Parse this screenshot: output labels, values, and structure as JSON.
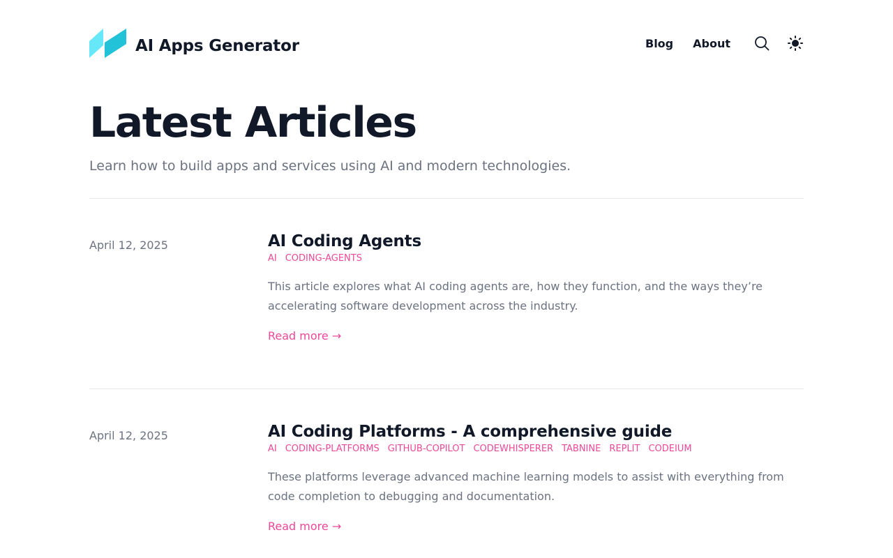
{
  "header": {
    "brand_name": "AI Apps Generator",
    "nav": [
      {
        "label": "Blog"
      },
      {
        "label": "About"
      }
    ],
    "icons": {
      "search": "search-icon",
      "theme": "sun-icon"
    }
  },
  "hero": {
    "title": "Latest Articles",
    "subtitle": "Learn how to build apps and services using AI and modern technologies."
  },
  "articles": [
    {
      "date": "April 12, 2025",
      "title": "AI Coding Agents",
      "tags": [
        "AI",
        "CODING-AGENTS"
      ],
      "excerpt": "This article explores what AI coding agents are, how they function, and the ways they’re accelerating software development across the industry.",
      "read_more": "Read more →"
    },
    {
      "date": "April 12, 2025",
      "title": "AI Coding Platforms - A comprehensive guide",
      "tags": [
        "AI",
        "CODING-PLATFORMS",
        "GITHUB-COPILOT",
        "CODEWHISPERER",
        "TABNINE",
        "REPLIT",
        "CODEIUM"
      ],
      "excerpt": "These platforms leverage advanced machine learning models to assist with everything from code completion to debugging and documentation.",
      "read_more": "Read more →"
    }
  ],
  "colors": {
    "accent": "#ec4899",
    "text": "#111827",
    "muted": "#6b7280",
    "divider": "#e5e7eb",
    "logo_light": "#67e8f9",
    "logo_dark": "#06b6d4"
  }
}
